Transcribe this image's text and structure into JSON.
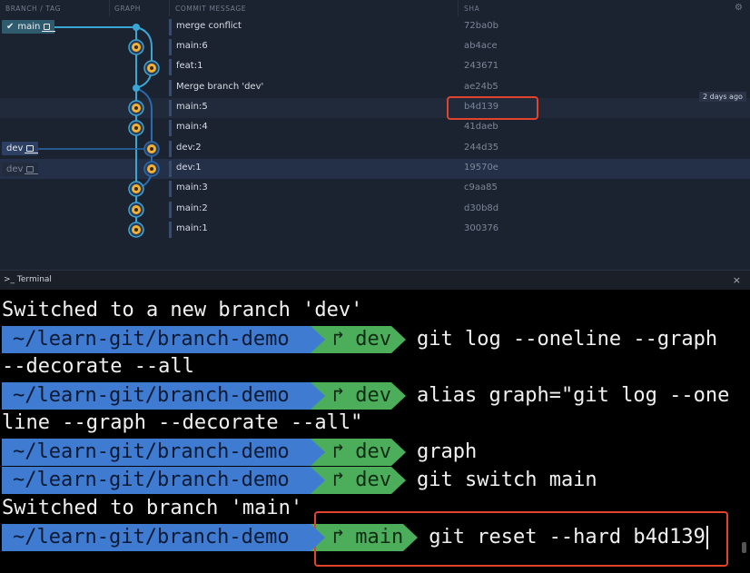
{
  "graph": {
    "headers": {
      "branch_tag": "BRANCH / TAG",
      "graph": "GRAPH",
      "commit_message": "COMMIT MESSAGE",
      "sha": "SHA"
    },
    "tooltip": "2 days ago",
    "branches": {
      "main": "main",
      "dev": "dev",
      "dev_remote": "dev"
    },
    "commits": [
      {
        "message": "merge conflict",
        "sha": "72ba0b"
      },
      {
        "message": "main:6",
        "sha": "ab4ace"
      },
      {
        "message": "feat:1",
        "sha": "243671"
      },
      {
        "message": "Merge branch 'dev'",
        "sha": "ae24b5"
      },
      {
        "message": "main:5",
        "sha": "b4d139"
      },
      {
        "message": "main:4",
        "sha": "41daeb"
      },
      {
        "message": "dev:2",
        "sha": "244d35"
      },
      {
        "message": "dev:1",
        "sha": "19570e"
      },
      {
        "message": "main:3",
        "sha": "c9aa85"
      },
      {
        "message": "main:2",
        "sha": "d30b8d"
      },
      {
        "message": "main:1",
        "sha": "300376"
      }
    ],
    "colors": {
      "main_lane": "#3ba6d4",
      "dev_lane": "#2a6ab0",
      "highlight": "#e2432d"
    }
  },
  "terminal": {
    "title": ">_ Terminal",
    "close": "×",
    "lines": {
      "l1": "Switched to a new branch 'dev'",
      "p1_path": "~/learn-git/branch-demo",
      "p1_branch": "dev",
      "p1_cmd": "git log --oneline --graph",
      "l3": "--decorate --all",
      "p2_path": "~/learn-git/branch-demo",
      "p2_branch": "dev",
      "p2_cmd": "alias graph=\"git log --one",
      "l5": "line --graph --decorate --all\"",
      "p3_path": "~/learn-git/branch-demo",
      "p3_branch": "dev",
      "p3_cmd": "graph",
      "p4_path": "~/learn-git/branch-demo",
      "p4_branch": "dev",
      "p4_cmd": "git switch main",
      "l8": "Switched to branch 'main'",
      "p5_path": "~/learn-git/branch-demo",
      "p5_branch": "main",
      "p5_cmd": "git reset --hard b4d139"
    },
    "branch_glyph": "↱"
  }
}
